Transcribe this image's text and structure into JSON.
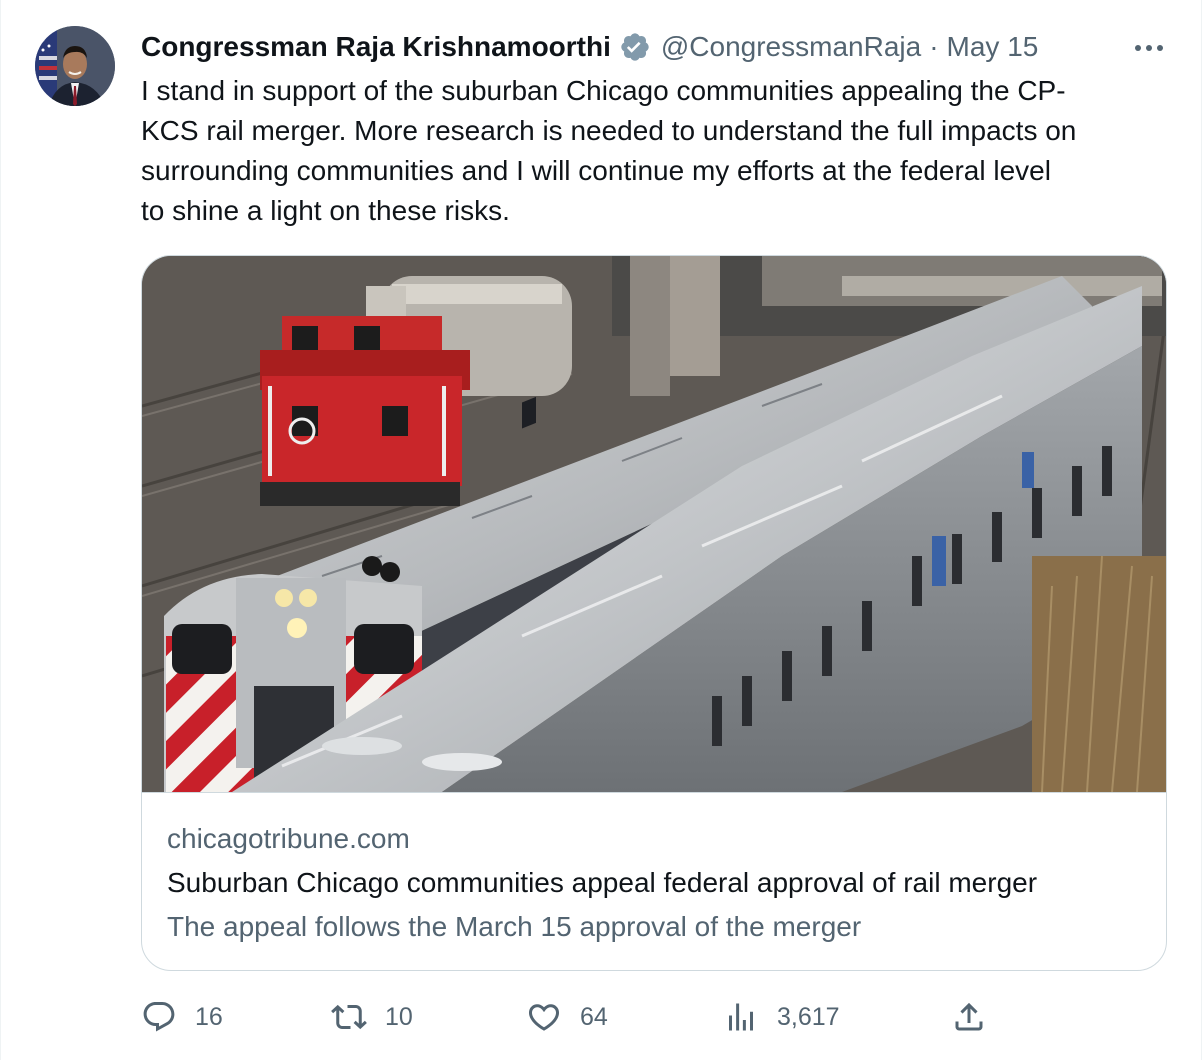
{
  "tweet": {
    "display_name": "Congressman Raja Krishnamoorthi",
    "handle": "@CongressmanRaja",
    "separator": "·",
    "date": "May 15",
    "text": "I stand in support of the suburban Chicago communities appealing the CP-\nKCS rail merger. More research is needed to understand the full impacts on\nsurrounding communities and I will continue my efforts at the federal level\nto shine a light on these risks."
  },
  "icons": {
    "avatar": "avatar",
    "verified": "verified-badge-icon",
    "more": "more-icon",
    "reply": "reply-icon",
    "retweet": "retweet-icon",
    "like": "like-icon",
    "views": "views-icon",
    "share": "share-icon"
  },
  "card": {
    "image_description": "photo-trains",
    "domain": "chicagotribune.com",
    "title": "Suburban Chicago communities appeal federal approval of rail merger",
    "description": "The appeal follows the March 15 approval of the merger"
  },
  "actions": {
    "replies": "16",
    "retweets": "10",
    "likes": "64",
    "views": "3,617"
  },
  "colors": {
    "text_primary": "#0f1419",
    "text_secondary": "#536471",
    "border": "#cfd9de",
    "verified": "#829aab"
  }
}
